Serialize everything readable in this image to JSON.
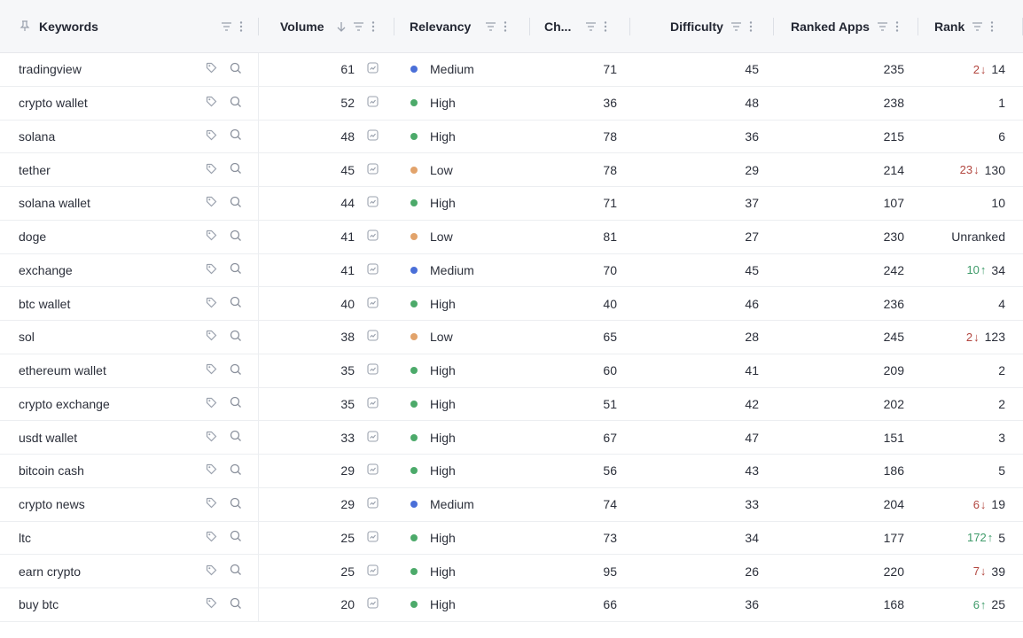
{
  "header": {
    "keywords": "Keywords",
    "volume": "Volume",
    "relevancy": "Relevancy",
    "chance": "Ch...",
    "difficulty": "Difficulty",
    "ranked_apps": "Ranked Apps",
    "rank": "Rank"
  },
  "colors": {
    "Medium": "#4a6fd8",
    "High": "#4caa6a",
    "Low": "#e2a36b"
  },
  "icons": {
    "keyword_tag": "tag-icon",
    "keyword_search": "search-icon",
    "volume_trend": "trend-chart-icon",
    "pin": "pin-icon",
    "filter": "filter-icon",
    "menu": "kebab-menu-icon",
    "sort": "sort-down-icon"
  },
  "rows": [
    {
      "keyword": "tradingview",
      "volume": "61",
      "relevancy": "Medium",
      "chance": "71",
      "difficulty": "45",
      "ranked_apps": "235",
      "rank": "14",
      "rank_change": "2",
      "rank_dir": "down"
    },
    {
      "keyword": "crypto wallet",
      "volume": "52",
      "relevancy": "High",
      "chance": "36",
      "difficulty": "48",
      "ranked_apps": "238",
      "rank": "1",
      "rank_change": "",
      "rank_dir": ""
    },
    {
      "keyword": "solana",
      "volume": "48",
      "relevancy": "High",
      "chance": "78",
      "difficulty": "36",
      "ranked_apps": "215",
      "rank": "6",
      "rank_change": "",
      "rank_dir": ""
    },
    {
      "keyword": "tether",
      "volume": "45",
      "relevancy": "Low",
      "chance": "78",
      "difficulty": "29",
      "ranked_apps": "214",
      "rank": "130",
      "rank_change": "23",
      "rank_dir": "down"
    },
    {
      "keyword": "solana wallet",
      "volume": "44",
      "relevancy": "High",
      "chance": "71",
      "difficulty": "37",
      "ranked_apps": "107",
      "rank": "10",
      "rank_change": "",
      "rank_dir": ""
    },
    {
      "keyword": "doge",
      "volume": "41",
      "relevancy": "Low",
      "chance": "81",
      "difficulty": "27",
      "ranked_apps": "230",
      "rank": "Unranked",
      "rank_change": "",
      "rank_dir": ""
    },
    {
      "keyword": "exchange",
      "volume": "41",
      "relevancy": "Medium",
      "chance": "70",
      "difficulty": "45",
      "ranked_apps": "242",
      "rank": "34",
      "rank_change": "10",
      "rank_dir": "up"
    },
    {
      "keyword": "btc wallet",
      "volume": "40",
      "relevancy": "High",
      "chance": "40",
      "difficulty": "46",
      "ranked_apps": "236",
      "rank": "4",
      "rank_change": "",
      "rank_dir": ""
    },
    {
      "keyword": "sol",
      "volume": "38",
      "relevancy": "Low",
      "chance": "65",
      "difficulty": "28",
      "ranked_apps": "245",
      "rank": "123",
      "rank_change": "2",
      "rank_dir": "down"
    },
    {
      "keyword": "ethereum wallet",
      "volume": "35",
      "relevancy": "High",
      "chance": "60",
      "difficulty": "41",
      "ranked_apps": "209",
      "rank": "2",
      "rank_change": "",
      "rank_dir": ""
    },
    {
      "keyword": "crypto exchange",
      "volume": "35",
      "relevancy": "High",
      "chance": "51",
      "difficulty": "42",
      "ranked_apps": "202",
      "rank": "2",
      "rank_change": "",
      "rank_dir": ""
    },
    {
      "keyword": "usdt wallet",
      "volume": "33",
      "relevancy": "High",
      "chance": "67",
      "difficulty": "47",
      "ranked_apps": "151",
      "rank": "3",
      "rank_change": "",
      "rank_dir": ""
    },
    {
      "keyword": "bitcoin cash",
      "volume": "29",
      "relevancy": "High",
      "chance": "56",
      "difficulty": "43",
      "ranked_apps": "186",
      "rank": "5",
      "rank_change": "",
      "rank_dir": ""
    },
    {
      "keyword": "crypto news",
      "volume": "29",
      "relevancy": "Medium",
      "chance": "74",
      "difficulty": "33",
      "ranked_apps": "204",
      "rank": "19",
      "rank_change": "6",
      "rank_dir": "down"
    },
    {
      "keyword": "ltc",
      "volume": "25",
      "relevancy": "High",
      "chance": "73",
      "difficulty": "34",
      "ranked_apps": "177",
      "rank": "5",
      "rank_change": "172",
      "rank_dir": "up"
    },
    {
      "keyword": "earn crypto",
      "volume": "25",
      "relevancy": "High",
      "chance": "95",
      "difficulty": "26",
      "ranked_apps": "220",
      "rank": "39",
      "rank_change": "7",
      "rank_dir": "down"
    },
    {
      "keyword": "buy btc",
      "volume": "20",
      "relevancy": "High",
      "chance": "66",
      "difficulty": "36",
      "ranked_apps": "168",
      "rank": "25",
      "rank_change": "6",
      "rank_dir": "up"
    }
  ]
}
